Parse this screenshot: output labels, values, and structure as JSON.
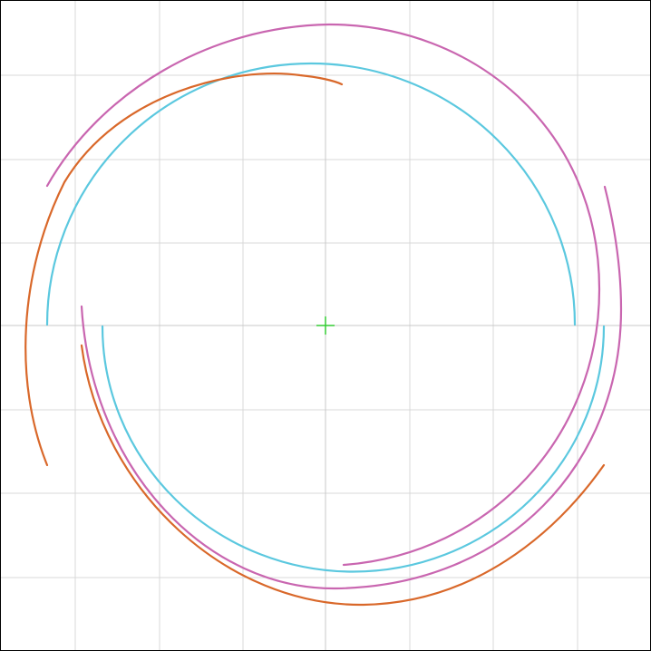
{
  "colors": {
    "grid": "#d9d9d9",
    "axis": "#c8c8c8",
    "center_marker": "#33cc33",
    "cyan_arc": "#5bc8df",
    "magenta_arc": "#c966b0",
    "orange_arc": "#d9682a",
    "frame": "#000000"
  },
  "icons": {
    "center_marker": "plus-crosshair"
  }
}
